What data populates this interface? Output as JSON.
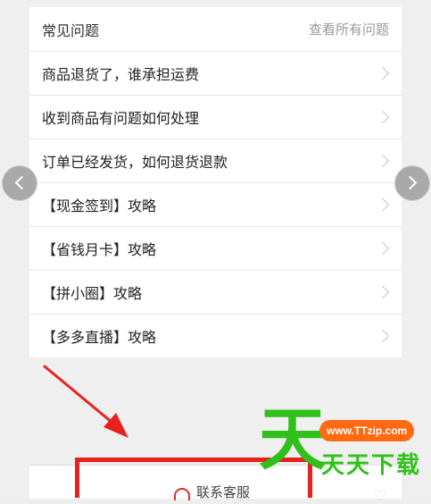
{
  "faq": {
    "title": "常见问题",
    "view_all": "查看所有问题",
    "items": [
      {
        "label": "商品退货了，谁承担运费"
      },
      {
        "label": "收到商品有问题如何处理"
      },
      {
        "label": "订单已经发货，如何退货退款"
      },
      {
        "label": "【现金签到】攻略"
      },
      {
        "label": "【省钱月卡】攻略"
      },
      {
        "label": "【拼小圈】攻略"
      },
      {
        "label": "【多多直播】攻略"
      }
    ]
  },
  "bottom": {
    "contact_label": "联系客服"
  },
  "watermark": {
    "big_char": "天",
    "url": "www.TTzip.com",
    "text": "天天下载"
  },
  "colors": {
    "highlight": "#e8211e",
    "brand_green": "#2fc01a",
    "brand_orange": "#ff6a13",
    "accent_red": "#e02e24"
  }
}
